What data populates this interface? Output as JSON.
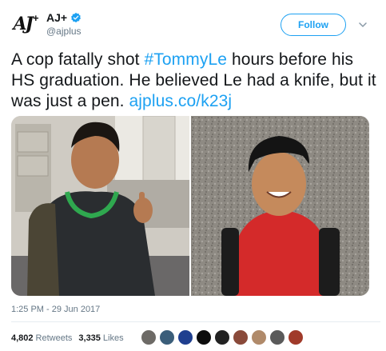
{
  "account": {
    "display_name": "AJ+",
    "handle": "@ajplus",
    "logo_text": "AJ",
    "logo_plus": "+"
  },
  "follow": {
    "label": "Follow"
  },
  "tweet": {
    "text_part1": "A cop fatally shot ",
    "hashtag": "#TommyLe",
    "text_part2": " hours before his HS graduation. He believed Le had a knife, but it was just a pen. ",
    "link": "ajplus.co/k23j"
  },
  "timestamp": "1:25 PM - 29 Jun 2017",
  "stats": {
    "retweets_count": "4,802",
    "retweets_label": "Retweets",
    "likes_count": "3,335",
    "likes_label": "Likes"
  },
  "colors": {
    "accent": "#1da1f2",
    "text": "#14171a",
    "muted": "#657786"
  },
  "icons": {
    "verified": "verified-badge-icon",
    "caret": "chevron-down-icon"
  }
}
